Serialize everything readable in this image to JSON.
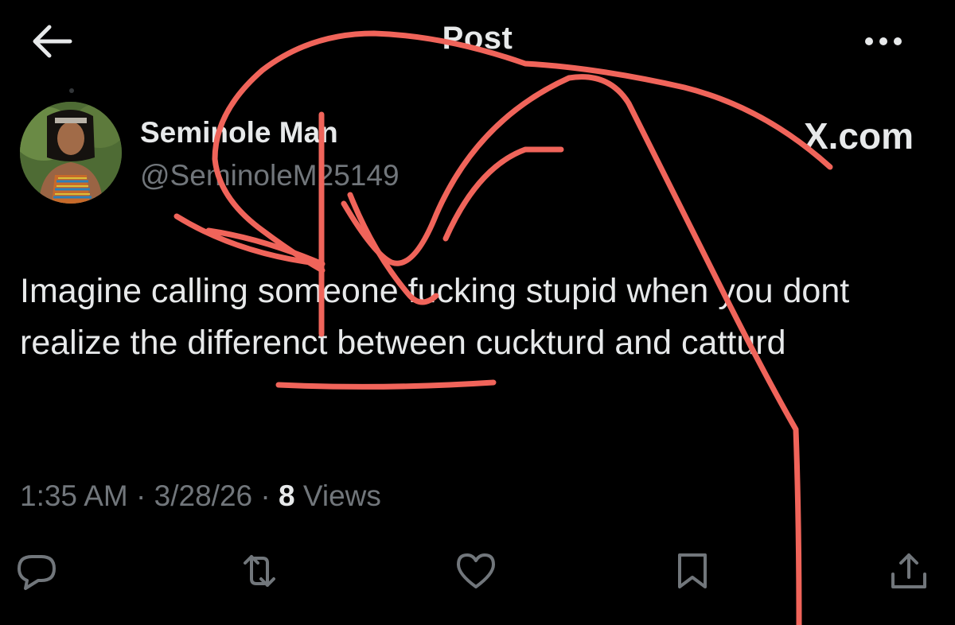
{
  "header": {
    "back_icon": "arrow-left-icon",
    "title": "Post",
    "more_icon": "more-horizontal-icon"
  },
  "post": {
    "author": {
      "name": "Seminole Man",
      "handle": "@SeminoleM25149",
      "avatar_description": "avatar"
    },
    "watermark": "X.com",
    "text": "Imagine calling someone fucking stupid when you dont realize the differenct between cuckturd and catturd",
    "time": "1:35 AM",
    "date": "3/28/26",
    "separator": "·",
    "views_count": "8",
    "views_label": "Views"
  },
  "actions": [
    {
      "name": "reply",
      "icon": "reply-icon"
    },
    {
      "name": "repost",
      "icon": "repost-icon"
    },
    {
      "name": "like",
      "icon": "heart-icon"
    },
    {
      "name": "bookmark",
      "icon": "bookmark-icon"
    },
    {
      "name": "share",
      "icon": "share-icon"
    }
  ],
  "colors": {
    "background": "#000000",
    "primary_text": "#e7e9ea",
    "secondary_text": "#71767b",
    "annotation": "#f0645a"
  }
}
